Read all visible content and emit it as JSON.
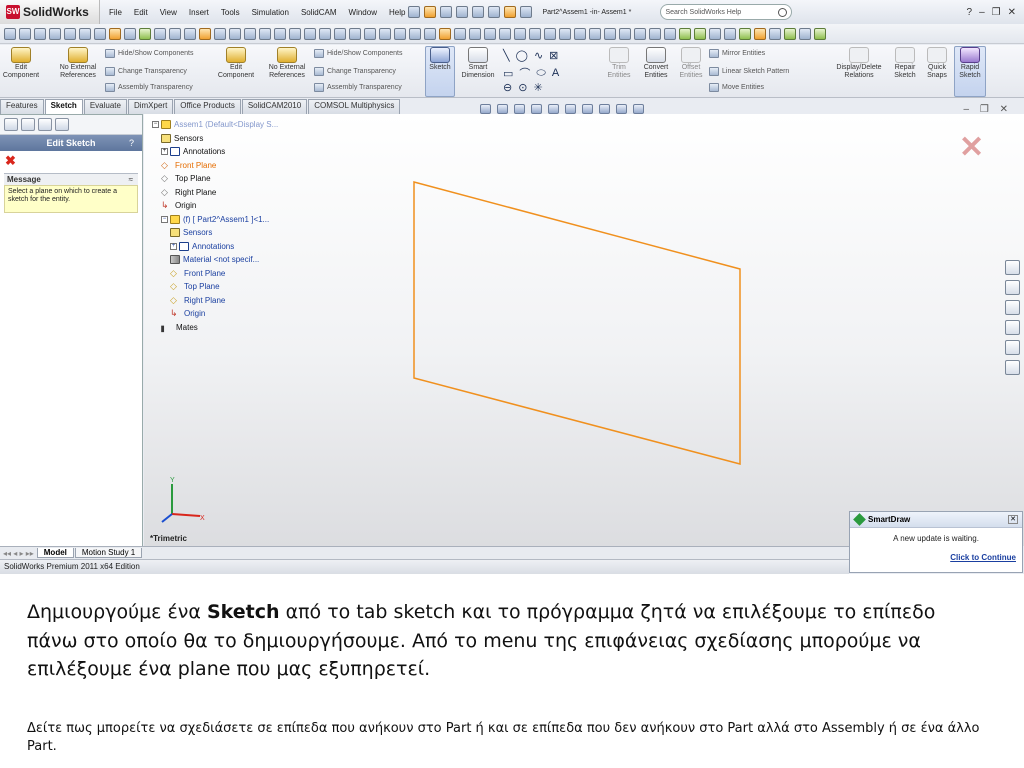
{
  "app": {
    "name": "SolidWorks",
    "document_title": "Part2^Assem1 -in- Assem1 *"
  },
  "menu": [
    "File",
    "Edit",
    "View",
    "Insert",
    "Tools",
    "Simulation",
    "SolidCAM",
    "Window",
    "Help"
  ],
  "search": {
    "placeholder": "Search SolidWorks Help"
  },
  "ribbon": {
    "edit_component": "Edit Component",
    "no_external_refs": "No External References",
    "hide_show": "Hide/Show Components",
    "change_transparency": "Change Transparency",
    "assembly_transparency": "Assembly Transparency",
    "edit_component_2": "Edit Component",
    "no_external_refs_2": "No External References",
    "hide_show_2": "Hide/Show Components",
    "change_transparency_2": "Change Transparency",
    "assembly_transparency_2": "Assembly Transparency",
    "sketch": "Sketch",
    "smart_dimension": "Smart Dimension",
    "trim_entities": "Trim Entities",
    "convert_entities": "Convert Entities",
    "offset_entities": "Offset Entities",
    "mirror_entities": "Mirror Entities",
    "linear_sketch_pattern": "Linear Sketch Pattern",
    "move_entities": "Move Entities",
    "display_delete_relations": "Display/Delete Relations",
    "repair_sketch": "Repair Sketch",
    "quick_snaps": "Quick Snaps",
    "rapid_sketch": "Rapid Sketch"
  },
  "tabs": [
    "Features",
    "Sketch",
    "Evaluate",
    "DimXpert",
    "Office Products",
    "SolidCAM2010",
    "COMSOL Multiphysics"
  ],
  "left_panel": {
    "title": "Edit Sketch",
    "help": "?",
    "message_header": "Message",
    "message_text": "Select a plane on which to create a sketch for the entity."
  },
  "tree": {
    "root": "Assem1 (Default<Display S...",
    "items": [
      "Sensors",
      "Annotations",
      "Front Plane",
      "Top Plane",
      "Right Plane",
      "Origin",
      "(f) [ Part2^Assem1 ]<1...",
      "Sensors",
      "Annotations",
      "Material <not specif...",
      "Front Plane",
      "Top Plane",
      "Right Plane",
      "Origin",
      "Mates"
    ]
  },
  "viewport": {
    "view_name": "*Trimetric",
    "plane_color": "#f0901e"
  },
  "smartdraw": {
    "title": "SmartDraw",
    "message": "A new update is waiting.",
    "link": "Click to Continue"
  },
  "bottom_tabs": [
    "Model",
    "Motion Study 1"
  ],
  "status_bar": "SolidWorks Premium 2011 x64 Edition",
  "caption": {
    "pre": "Δημιουργούμε ένα ",
    "bold": "Sketch",
    "post": " από το tab sketch και το πρόγραμμα ζητά να επιλέξουμε το επίπεδο πάνω στο οποίο θα το δημιουργήσουμε. Από το menu της επιφάνειας σχεδίασης μπορούμε να επιλέξουμε ένα plane που μας εξυπηρετεί.",
    "note": "Δείτε πως μπορείτε να σχεδιάσετε σε επίπεδα που ανήκουν στο Part ή και σε επίπεδα που δεν ανήκουν στο Part αλλά στο Assembly ή σε ένα άλλο Part."
  }
}
